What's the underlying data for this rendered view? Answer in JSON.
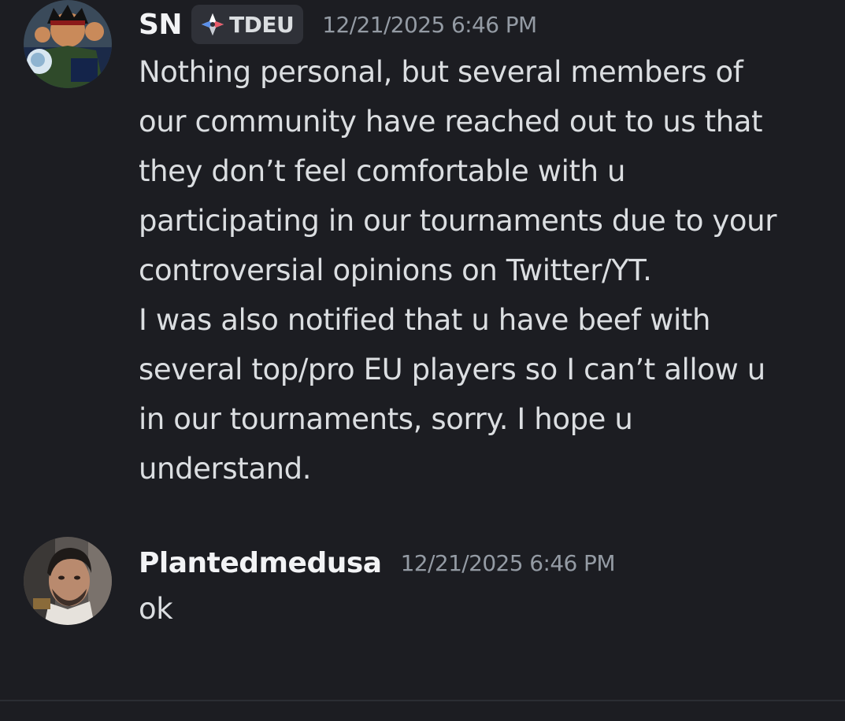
{
  "messages": [
    {
      "username": "SN",
      "tag": "TDEU",
      "timestamp": "12/21/2025 6:46 PM",
      "lines": [
        "Nothing personal, but several members of",
        "our community have reached out to us that",
        "they don’t feel comfortable with u",
        "participating in our tournaments due to your",
        "controversial opinions on Twitter/YT.",
        "I was also notified that u have beef with",
        "several top/pro EU players so I can’t allow u",
        "in our tournaments, sorry. I hope u",
        "understand."
      ]
    },
    {
      "username": "Plantedmedusa",
      "timestamp": "12/21/2025 6:46 PM",
      "lines": [
        "ok"
      ]
    }
  ],
  "colors": {
    "background": "#1c1d22",
    "username": "#f2f3f5",
    "text": "#dbdee1",
    "timestamp": "#949ba4",
    "tag_background": "#2f3138"
  },
  "icons": {
    "tag_icon": "diamond-compass-icon"
  }
}
